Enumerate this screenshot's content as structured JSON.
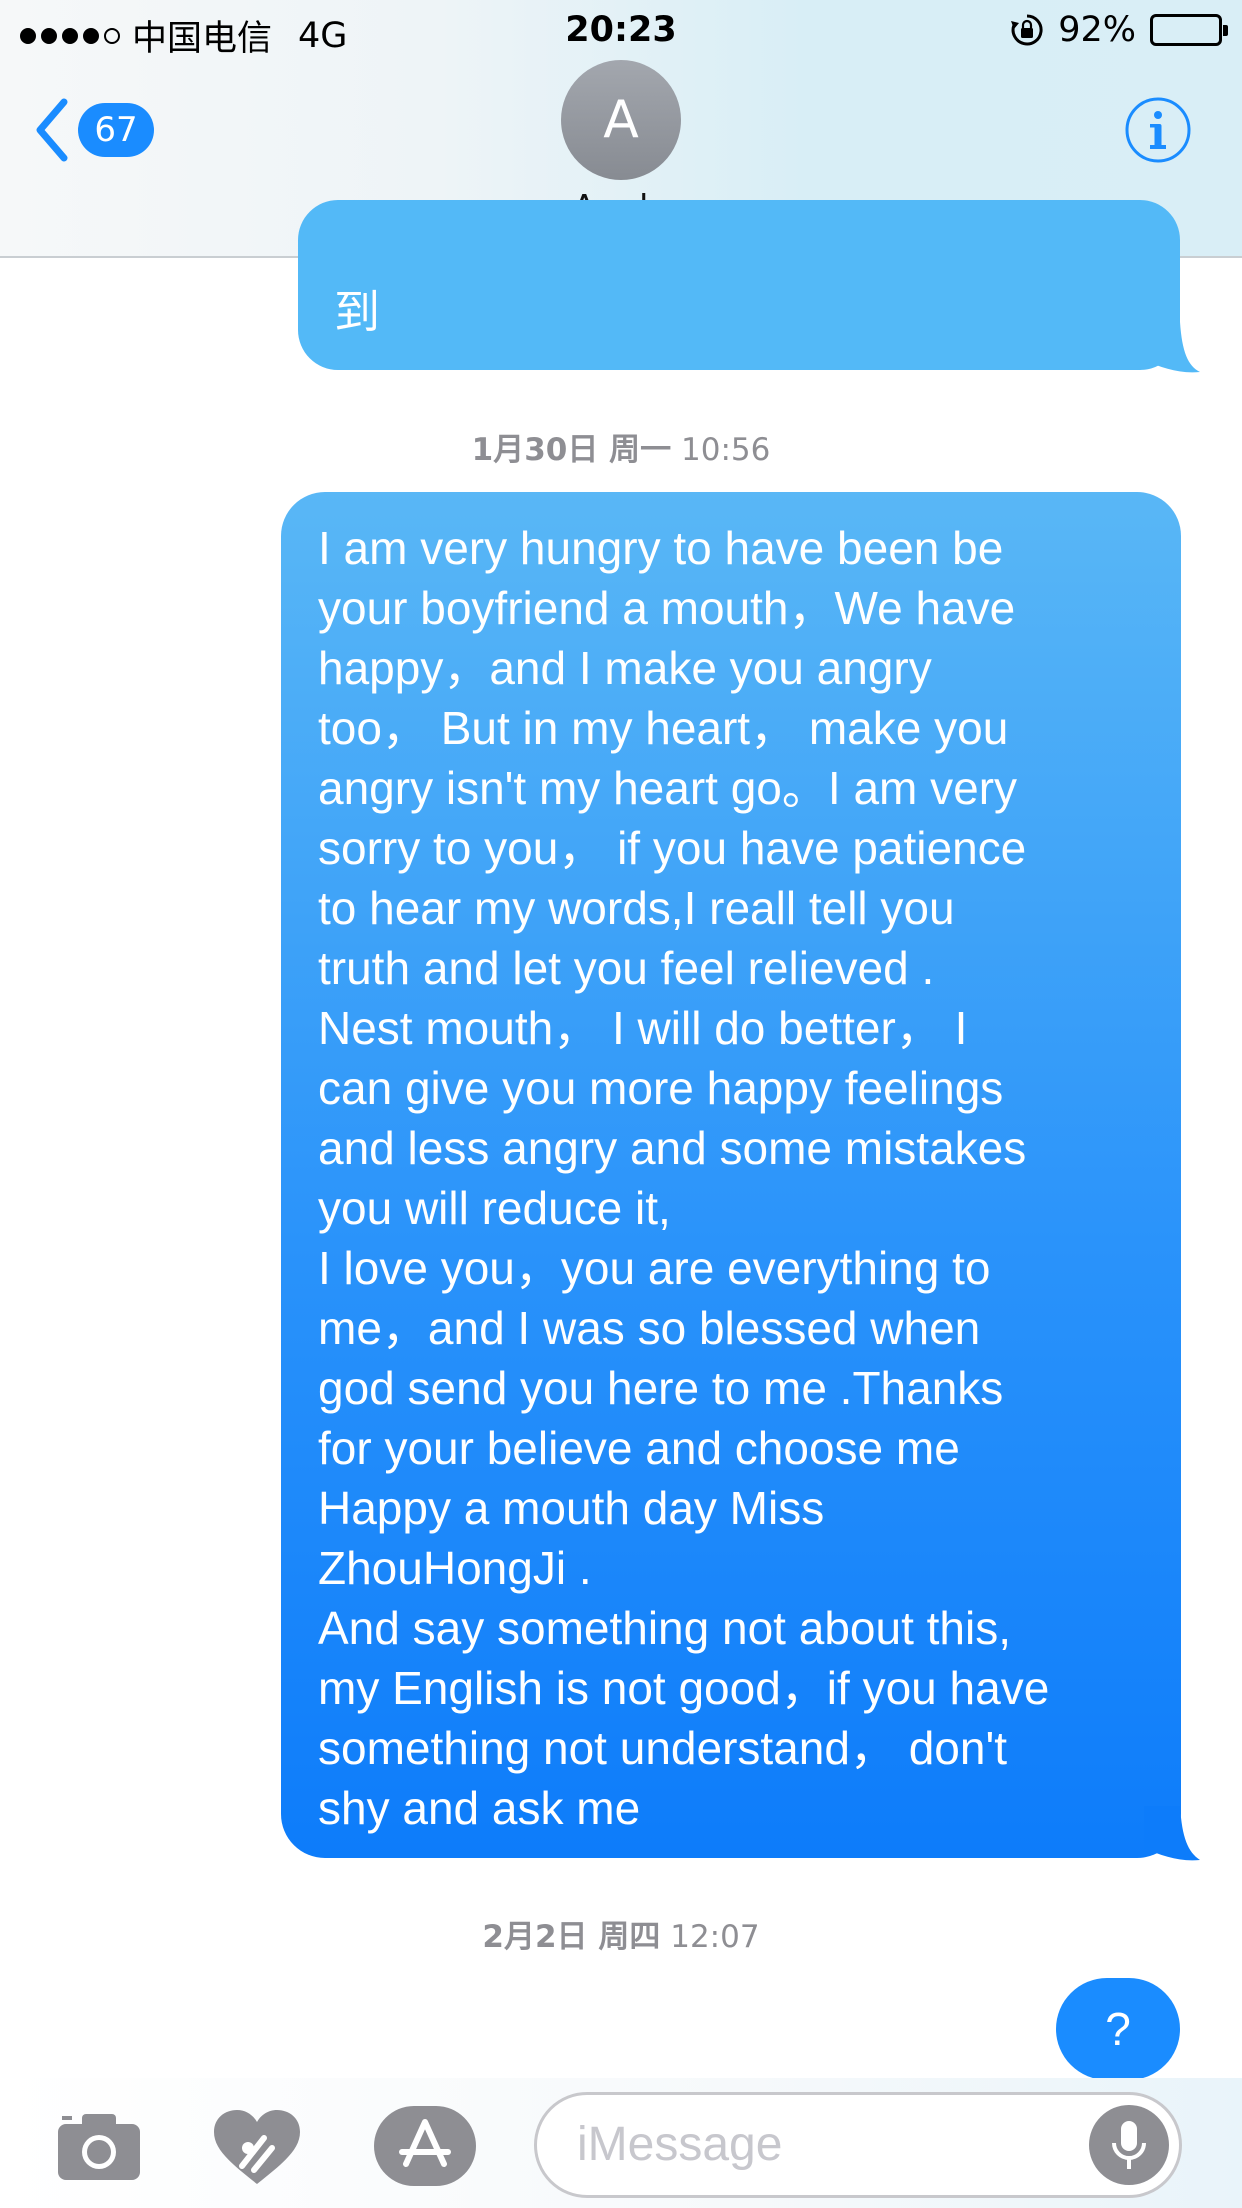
{
  "status_bar": {
    "carrier": "中国电信",
    "network": "4G",
    "time": "20:23",
    "battery_percent": "92%",
    "battery_level": 0.92
  },
  "nav": {
    "back_count": "67",
    "contact_initial": "A",
    "contact_name": "Angle"
  },
  "messages": {
    "partial_bubble_text": "到",
    "timestamp_1_date": "1月30日 周一",
    "timestamp_1_time": "10:56",
    "main_bubble_text": "I am very hungry to have been be\nyour boyfriend a mouth，We have\nhappy，and I make you angry\ntoo， But in my heart， make you\nangry isn't my heart go。I am very\nsorry to you， if you have patience\nto hear my words,I reall tell you\ntruth and let you feel relieved .\nNest mouth， I will do better， I\ncan give you more happy feelings\nand less angry and some mistakes\nyou will reduce it,\nI love you，you are everything to\nme，and I was so blessed when\ngod send you here to me .Thanks\nfor your believe and choose me\nHappy a mouth day Miss\nZhouHongJi .\nAnd say something not about this,\nmy English is not good，if you have\nsomething not understand， don't\nshy and ask me",
    "timestamp_2_date": "2月2日 周四",
    "timestamp_2_time": "12:07",
    "small_bubble_text": "?"
  },
  "toolbar": {
    "input_placeholder": "iMessage",
    "icons": [
      "camera-icon",
      "digital-touch-heart-icon",
      "app-store-icon",
      "microphone-icon"
    ]
  },
  "colors": {
    "accent": "#1a8cff",
    "bubble_light": "#53b9f7",
    "bubble_dark": "#0d7cfa",
    "timestamp_gray": "#8e8e93"
  }
}
